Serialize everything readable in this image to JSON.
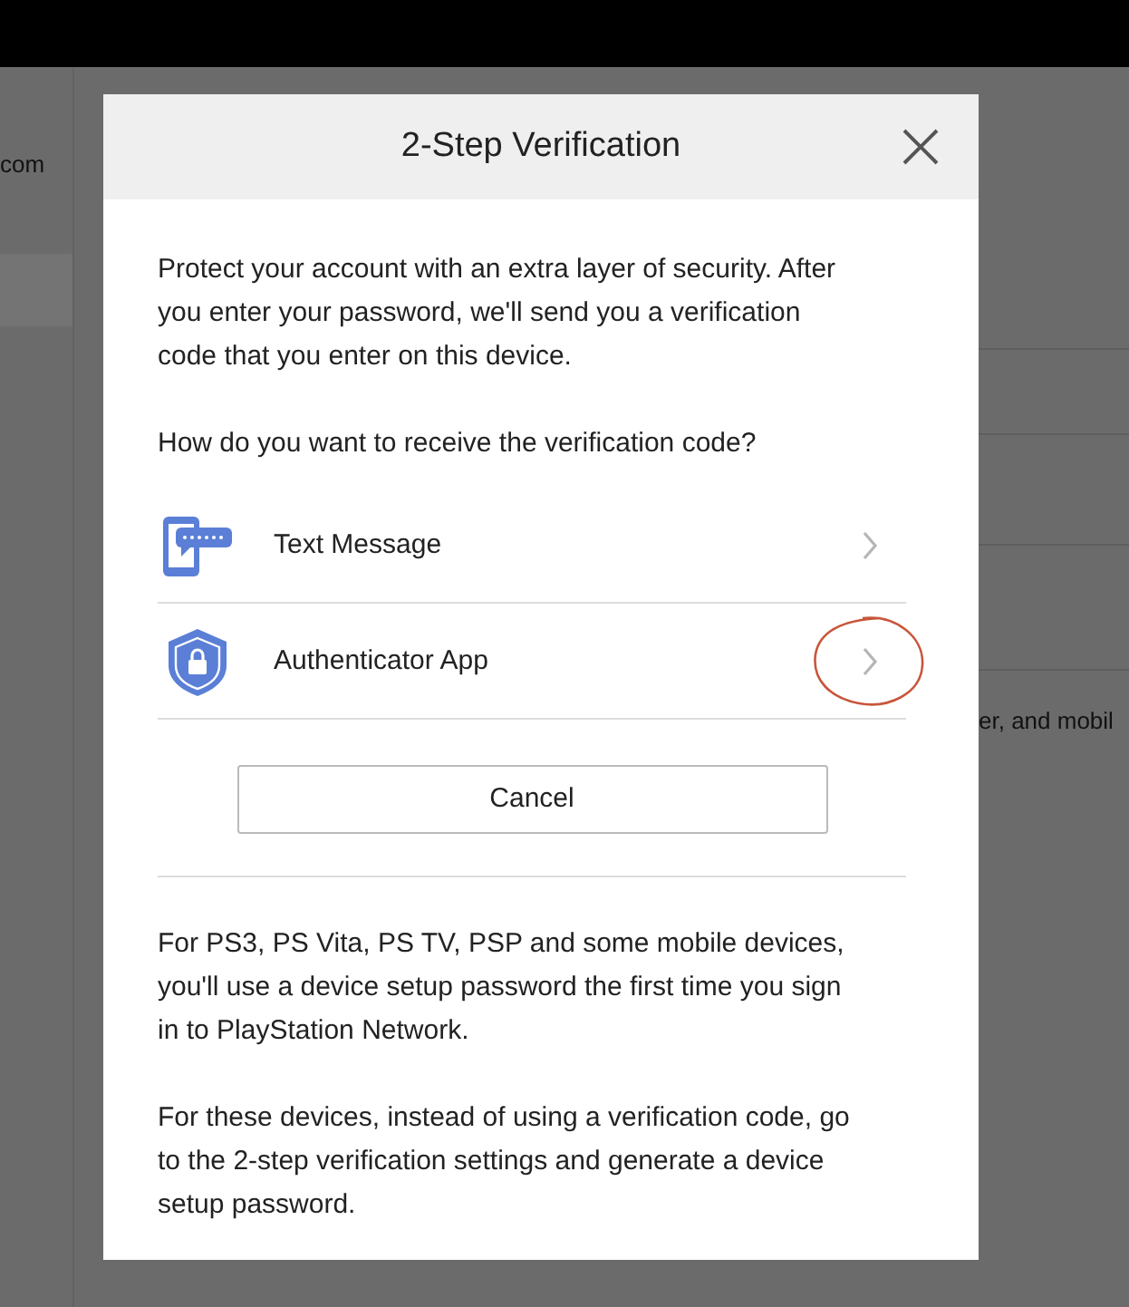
{
  "background": {
    "left_text": "com",
    "right_text": "er, and mobil"
  },
  "dialog": {
    "title": "2-Step Verification",
    "intro": "Protect your account with an extra layer of security. After you enter your password, we'll send you a verification code that you enter on this device.",
    "question": "How do you want to receive the verification code?",
    "options": [
      {
        "kind": "sms",
        "label": "Text Message",
        "annotated": false
      },
      {
        "kind": "authenticator",
        "label": "Authenticator App",
        "annotated": true
      }
    ],
    "cancel": "Cancel",
    "notes": [
      "For PS3, PS Vita, PS TV, PSP and some mobile devices, you'll use a device setup password the first time you sign in to PlayStation Network.",
      "For these devices, instead of using a verification code, go to the 2-step verification settings and generate a device setup password."
    ]
  }
}
